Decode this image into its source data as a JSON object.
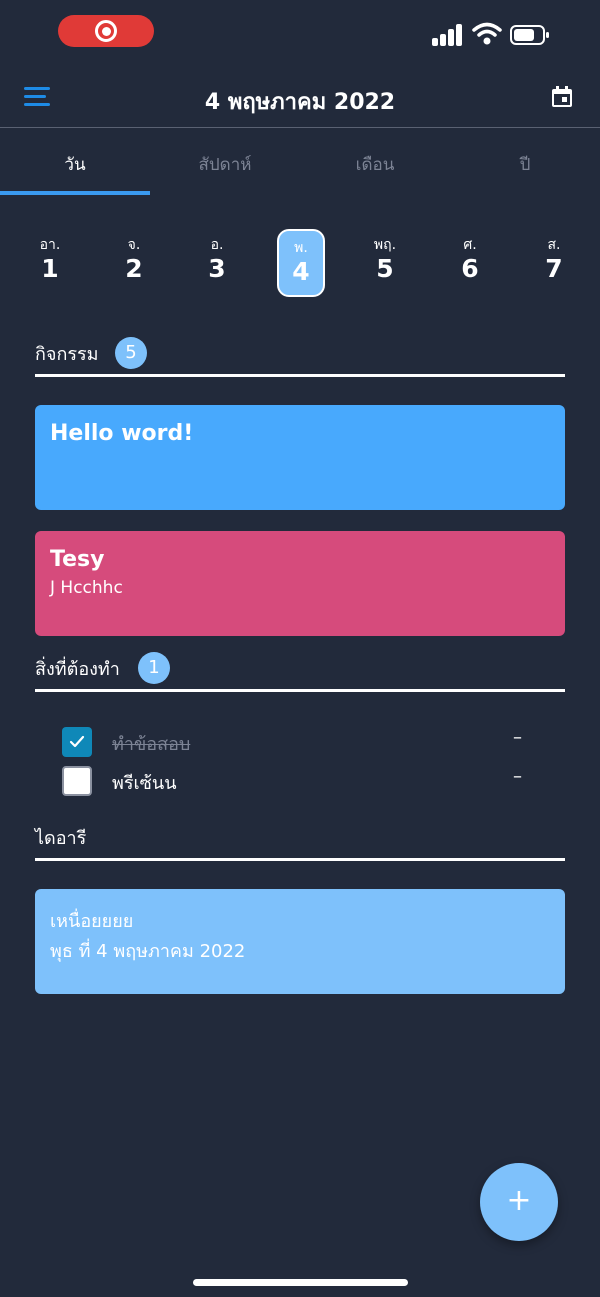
{
  "status_bar": {
    "recording_icon": "record-icon",
    "signal_icon": "cellular-signal-icon",
    "wifi_icon": "wifi-icon",
    "battery_icon": "battery-icon"
  },
  "app_bar": {
    "menu_icon": "hamburger-menu-icon",
    "title": "4 พฤษภาคม 2022",
    "calendar_icon": "calendar-icon",
    "accent_color": "#1e8be6"
  },
  "tabs": [
    {
      "label": "วัน",
      "active": true
    },
    {
      "label": "สัปดาห์",
      "active": false
    },
    {
      "label": "เดือน",
      "active": false
    },
    {
      "label": "ปี",
      "active": false
    }
  ],
  "days": [
    {
      "dow": "อา.",
      "num": "1"
    },
    {
      "dow": "จ.",
      "num": "2"
    },
    {
      "dow": "อ.",
      "num": "3"
    },
    {
      "dow": "พ.",
      "num": "4",
      "selected": true
    },
    {
      "dow": "พฤ.",
      "num": "5"
    },
    {
      "dow": "ศ.",
      "num": "6"
    },
    {
      "dow": "ส.",
      "num": "7"
    }
  ],
  "activities": {
    "title": "กิจกรรม",
    "count": "5",
    "cards": [
      {
        "title": "Hello word!",
        "subtitle": "",
        "color": "#48a9fd"
      },
      {
        "title": "Tesy",
        "subtitle": "J Hcchhc",
        "color": "#d64b7c"
      }
    ]
  },
  "todos": {
    "title": "สิ่งที่ต้องทำ",
    "count": "1",
    "items": [
      {
        "text": "ทำข้อสอบ",
        "done": true,
        "dash": "–"
      },
      {
        "text": "พรีเซ้นน",
        "done": false,
        "dash": "–"
      }
    ]
  },
  "diary": {
    "title": "ไดอารี",
    "entry_title": "เหนื่อยยยย",
    "entry_date": "พุธ ที่ 4 พฤษภาคม 2022",
    "color": "#7ec1fb"
  },
  "fab": {
    "label": "+",
    "icon": "add-icon"
  },
  "colors": {
    "background": "#222a3b",
    "tab_indicator": "#3a9af0",
    "badge": "#7ec1fb",
    "checkbox_checked": "#0f88b8"
  }
}
